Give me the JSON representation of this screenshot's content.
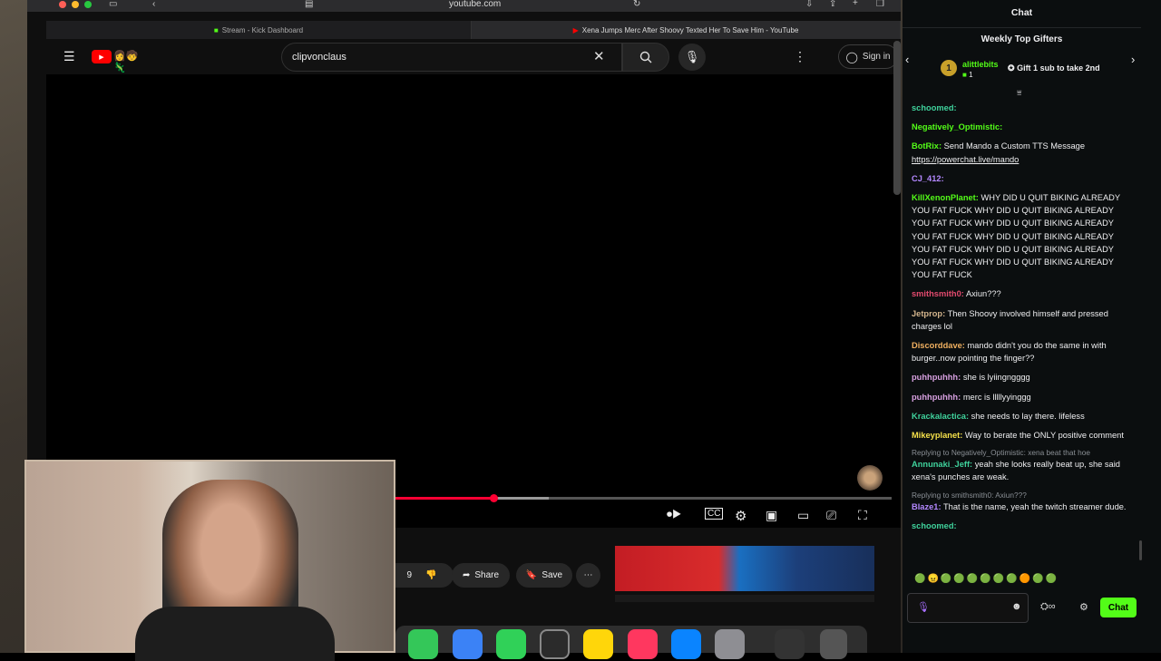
{
  "browser": {
    "address": "youtube.com",
    "tabs": [
      {
        "label": "Stream - Kick Dashboard"
      },
      {
        "label": "Xena Jumps Merc After Shoovy Texted Her To Save Him - YouTube"
      }
    ]
  },
  "youtube": {
    "search_value": "clipvonclaus",
    "sign_in": "Sign in",
    "share": "Share",
    "save": "Save",
    "like_count_partial": "9",
    "progress": 0.52,
    "buffered": 0.69
  },
  "chat": {
    "title": "Chat",
    "gifters_title": "Weekly Top Gifters",
    "top_gifter": {
      "rank": "1",
      "name": "alittlebits",
      "count": "1"
    },
    "gift_cta": "Gift 1 sub to take 2nd",
    "send_label": "Chat",
    "messages": [
      {
        "user": "schoomed:",
        "color": "#3fd29c",
        "text": ""
      },
      {
        "user": "Negatively_Optimistic:",
        "color": "#53fc18",
        "text": ""
      },
      {
        "user": "BotRix:",
        "color": "#53fc18",
        "text": "Send Mando a Custom TTS Message",
        "link": "https://powerchat.live/mando"
      },
      {
        "user": "CJ_412:",
        "color": "#b388ff",
        "text": ""
      },
      {
        "user": "KillXenonPlanet:",
        "color": "#53fc18",
        "text": "WHY DID U QUIT BIKING ALREADY YOU FAT FUCK WHY DID U QUIT BIKING ALREADY YOU FAT FUCK WHY DID U QUIT BIKING ALREADY YOU FAT FUCK WHY DID U QUIT BIKING ALREADY YOU FAT FUCK WHY DID U QUIT BIKING ALREADY YOU FAT FUCK WHY DID U QUIT BIKING ALREADY YOU FAT FUCK"
      },
      {
        "user": "smithsmith0:",
        "color": "#e24a6e",
        "text": "Axiun???"
      },
      {
        "user": "Jetprop:",
        "color": "#d2b48c",
        "text": "Then Shoovy involved himself and pressed charges lol"
      },
      {
        "user": "Discorddave:",
        "color": "#f0b060",
        "text": "mando didn't you do the same in with burger..now pointing the finger??"
      },
      {
        "user": "puhhpuhhh:",
        "color": "#d7a0e0",
        "text": "she is lyiingngggg"
      },
      {
        "user": "puhhpuhhh:",
        "color": "#d7a0e0",
        "text": "merc is lllllyyinggg"
      },
      {
        "user": "Krackalactica:",
        "color": "#3fd29c",
        "text": "she needs to lay there. lifeless"
      },
      {
        "user": "Mikeyplanet:",
        "color": "#f5e04a",
        "text": "Way to berate the ONLY positive comment"
      },
      {
        "reply": "Replying to Negatively_Optimistic: xena beat that hoe",
        "user": "Annunaki_Jeff:",
        "color": "#3fd29c",
        "text": "yeah she looks really beat up, she said xena's punches are weak."
      },
      {
        "reply": "Replying to smithsmith0: Axiun???",
        "user": "Blaze1:",
        "color": "#b388ff",
        "text": "That is the name, yeah the twitch streamer dude."
      },
      {
        "user": "schoomed:",
        "color": "#3fd29c",
        "text": ""
      }
    ]
  },
  "colors": {
    "kick_green": "#53fc18",
    "yt_red": "#ff0000"
  }
}
